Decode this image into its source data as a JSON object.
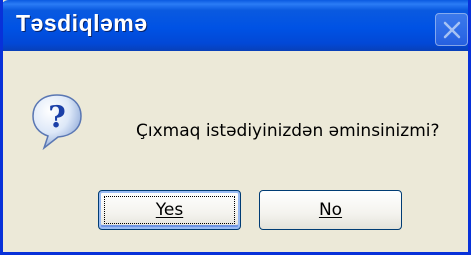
{
  "dialog": {
    "title": "Təsdiqləmə",
    "message": "Çıxmaq istədiyinizdən əminsinizmi?",
    "icon": "question-icon"
  },
  "buttons": {
    "yes_label": "Yes",
    "no_label": "No"
  },
  "colors": {
    "titlebar": "#0052e4",
    "window_bg": "#ece9d8",
    "frame": "#0831d9"
  }
}
